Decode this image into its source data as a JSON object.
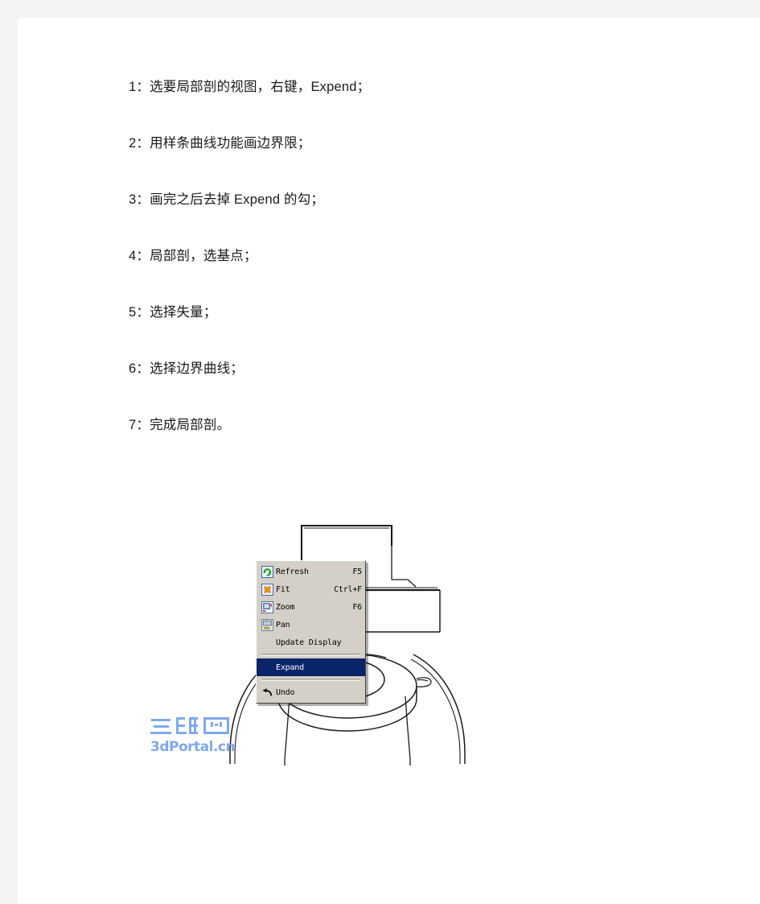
{
  "document": {
    "instructions": [
      {
        "id": 1,
        "text": "1：选要局部剖的视图，右键，Expend；"
      },
      {
        "id": 2,
        "text": "2：用样条曲线功能画边界限；"
      },
      {
        "id": 3,
        "text": "3：画完之后去掉 Expend 的勾；"
      },
      {
        "id": 4,
        "text": "4：局部剖，选基点；"
      },
      {
        "id": 5,
        "text": "5：选择失量；"
      },
      {
        "id": 6,
        "text": "6：选择边界曲线；"
      },
      {
        "id": 7,
        "text": "7：完成局部剖。"
      }
    ]
  },
  "watermark": {
    "line1": "三维网",
    "line2": "3dPortal.cn",
    "color": "#7fa9ee"
  },
  "context_menu": {
    "background_color": "#d4d0c8",
    "highlight_color": "#0a246a",
    "items": [
      {
        "label": "Refresh",
        "shortcut": "F5",
        "icon": "refresh-icon",
        "highlighted": false,
        "separator_after": false
      },
      {
        "label": "Fit",
        "shortcut": "Ctrl+F",
        "icon": "fit-icon",
        "highlighted": false,
        "separator_after": false
      },
      {
        "label": "Zoom",
        "shortcut": "F6",
        "icon": "zoom-icon",
        "highlighted": false,
        "separator_after": false
      },
      {
        "label": "Pan",
        "shortcut": "",
        "icon": "pan-icon",
        "highlighted": false,
        "separator_after": false
      },
      {
        "label": "Update Display",
        "shortcut": "",
        "icon": "",
        "highlighted": false,
        "separator_after": true
      },
      {
        "label": "Expand",
        "shortcut": "",
        "icon": "",
        "highlighted": true,
        "separator_after": true
      },
      {
        "label": "Undo",
        "shortcut": "",
        "icon": "undo-icon",
        "highlighted": false,
        "separator_after": false
      }
    ]
  },
  "cad_drawing": {
    "line_color": "#1a1a1a",
    "description": "mechanical part orthographic view"
  }
}
